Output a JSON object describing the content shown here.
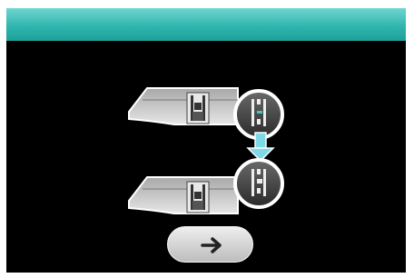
{
  "screen": {
    "title": "",
    "steps": [
      {
        "id": "presser-foot-before",
        "state": "up"
      },
      {
        "id": "presser-foot-after",
        "state": "down"
      }
    ],
    "step_arrow_icon": "arrow-down-icon",
    "next_button": {
      "icon": "arrow-right-icon",
      "label": ""
    }
  },
  "colors": {
    "title_bar": "#2fb6ae",
    "background": "#000000",
    "accent_arrow": "#7fd8e6",
    "button": "#d9d9d9"
  }
}
